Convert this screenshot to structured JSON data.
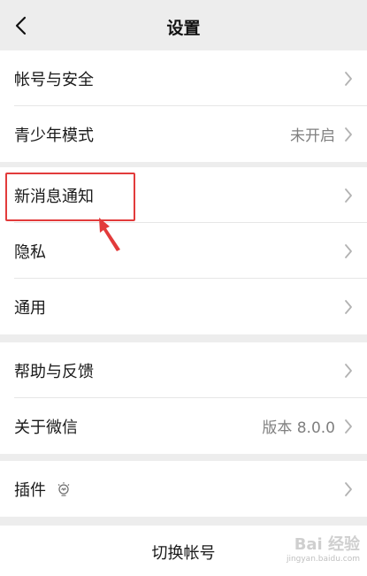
{
  "header": {
    "title": "设置"
  },
  "groups": [
    {
      "items": [
        {
          "label": "帐号与安全"
        },
        {
          "label": "青少年模式",
          "value": "未开启"
        }
      ]
    },
    {
      "items": [
        {
          "label": "新消息通知"
        },
        {
          "label": "隐私"
        },
        {
          "label": "通用"
        }
      ]
    },
    {
      "items": [
        {
          "label": "帮助与反馈"
        },
        {
          "label": "关于微信",
          "value": "版本 8.0.0"
        }
      ]
    },
    {
      "items": [
        {
          "label": "插件"
        }
      ]
    }
  ],
  "switch_account": "切换帐号",
  "watermark": {
    "main": "Bai 经验",
    "sub": "jingyan.baidu.com"
  },
  "colors": {
    "annotation": "#e23b3b",
    "background": "#ededed",
    "secondary_text": "#808080"
  },
  "icons": {
    "back": "chevron-left-icon",
    "row": "chevron-right-icon",
    "plugin": "lightbulb-icon"
  }
}
